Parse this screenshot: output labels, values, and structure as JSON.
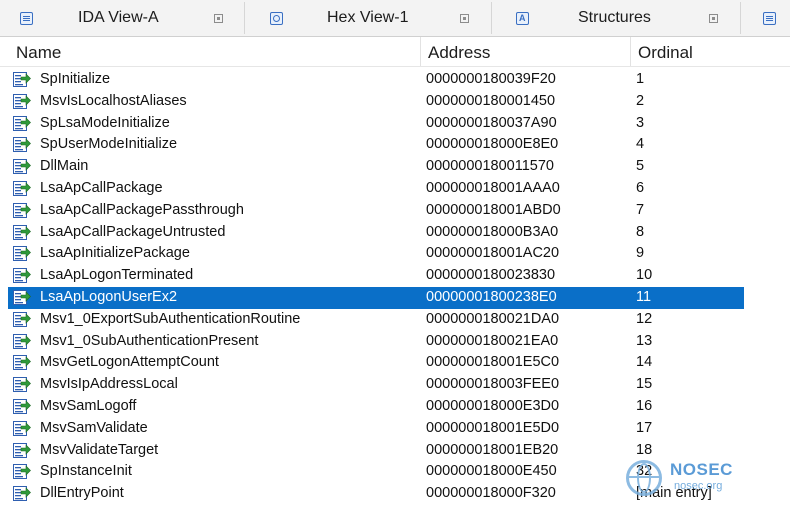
{
  "tabs": [
    {
      "label": "IDA View-A",
      "icon": "ida-view-icon"
    },
    {
      "label": "Hex View-1",
      "icon": "hex-view-icon"
    },
    {
      "label": "Structures",
      "icon": "structures-icon"
    }
  ],
  "columns": {
    "name": "Name",
    "address": "Address",
    "ordinal": "Ordinal"
  },
  "rows": [
    {
      "name": "SpInitialize",
      "address": "0000000180039F20",
      "ordinal": "1"
    },
    {
      "name": "MsvIsLocalhostAliases",
      "address": "0000000180001450",
      "ordinal": "2"
    },
    {
      "name": "SpLsaModeInitialize",
      "address": "0000000180037A90",
      "ordinal": "3"
    },
    {
      "name": "SpUserModeInitialize",
      "address": "000000018000E8E0",
      "ordinal": "4"
    },
    {
      "name": "DllMain",
      "address": "0000000180011570",
      "ordinal": "5"
    },
    {
      "name": "LsaApCallPackage",
      "address": "000000018001AAA0",
      "ordinal": "6"
    },
    {
      "name": "LsaApCallPackagePassthrough",
      "address": "000000018001ABD0",
      "ordinal": "7"
    },
    {
      "name": "LsaApCallPackageUntrusted",
      "address": "000000018000B3A0",
      "ordinal": "8"
    },
    {
      "name": "LsaApInitializePackage",
      "address": "000000018001AC20",
      "ordinal": "9"
    },
    {
      "name": "LsaApLogonTerminated",
      "address": "0000000180023830",
      "ordinal": "10"
    },
    {
      "name": "LsaApLogonUserEx2",
      "address": "00000001800238E0",
      "ordinal": "11",
      "selected": true
    },
    {
      "name": "Msv1_0ExportSubAuthenticationRoutine",
      "address": "0000000180021DA0",
      "ordinal": "12"
    },
    {
      "name": "Msv1_0SubAuthenticationPresent",
      "address": "0000000180021EA0",
      "ordinal": "13"
    },
    {
      "name": "MsvGetLogonAttemptCount",
      "address": "000000018001E5C0",
      "ordinal": "14"
    },
    {
      "name": "MsvIsIpAddressLocal",
      "address": "000000018003FEE0",
      "ordinal": "15"
    },
    {
      "name": "MsvSamLogoff",
      "address": "000000018000E3D0",
      "ordinal": "16"
    },
    {
      "name": "MsvSamValidate",
      "address": "000000018001E5D0",
      "ordinal": "17"
    },
    {
      "name": "MsvValidateTarget",
      "address": "000000018001EB20",
      "ordinal": "18"
    },
    {
      "name": "SpInstanceInit",
      "address": "000000018000E450",
      "ordinal": "32"
    },
    {
      "name": "DllEntryPoint",
      "address": "000000018000F320",
      "ordinal": "[main entry]"
    }
  ],
  "watermark": {
    "brand": "NOSEC",
    "domain": "nosec.org"
  },
  "colors": {
    "selection": "#0a6fc8",
    "icon_blue": "#2f5fb0",
    "icon_green": "#2f9a3a"
  }
}
